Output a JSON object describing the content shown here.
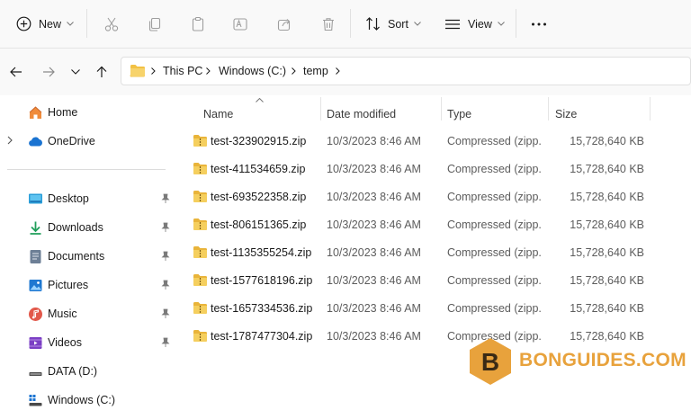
{
  "toolbar": {
    "new_label": "New",
    "sort_label": "Sort",
    "view_label": "View"
  },
  "address": {
    "crumbs": [
      "This PC",
      "Windows (C:)",
      "temp"
    ]
  },
  "sidebar": {
    "items": [
      {
        "label": "Home"
      },
      {
        "label": "OneDrive"
      },
      {
        "label": "Desktop"
      },
      {
        "label": "Downloads"
      },
      {
        "label": "Documents"
      },
      {
        "label": "Pictures"
      },
      {
        "label": "Music"
      },
      {
        "label": "Videos"
      },
      {
        "label": "DATA (D:)"
      },
      {
        "label": "Windows (C:)"
      }
    ]
  },
  "list": {
    "columns": [
      "Name",
      "Date modified",
      "Type",
      "Size"
    ],
    "rows": [
      {
        "name": "test-323902915.zip",
        "date": "10/3/2023 8:46 AM",
        "type": "Compressed (zipp...",
        "size": "15,728,640 KB"
      },
      {
        "name": "test-411534659.zip",
        "date": "10/3/2023 8:46 AM",
        "type": "Compressed (zipp...",
        "size": "15,728,640 KB"
      },
      {
        "name": "test-693522358.zip",
        "date": "10/3/2023 8:46 AM",
        "type": "Compressed (zipp...",
        "size": "15,728,640 KB"
      },
      {
        "name": "test-806151365.zip",
        "date": "10/3/2023 8:46 AM",
        "type": "Compressed (zipp...",
        "size": "15,728,640 KB"
      },
      {
        "name": "test-1135355254.zip",
        "date": "10/3/2023 8:46 AM",
        "type": "Compressed (zipp...",
        "size": "15,728,640 KB"
      },
      {
        "name": "test-1577618196.zip",
        "date": "10/3/2023 8:46 AM",
        "type": "Compressed (zipp...",
        "size": "15,728,640 KB"
      },
      {
        "name": "test-1657334536.zip",
        "date": "10/3/2023 8:46 AM",
        "type": "Compressed (zipp...",
        "size": "15,728,640 KB"
      },
      {
        "name": "test-1787477304.zip",
        "date": "10/3/2023 8:46 AM",
        "type": "Compressed (zipp...",
        "size": "15,728,640 KB"
      }
    ]
  },
  "watermark": {
    "letter": "B",
    "text": "BONGUIDES.COM"
  },
  "colors": {
    "accent": "#0067c0",
    "folder": "#f2c144",
    "watermark": "#e8a23c"
  }
}
